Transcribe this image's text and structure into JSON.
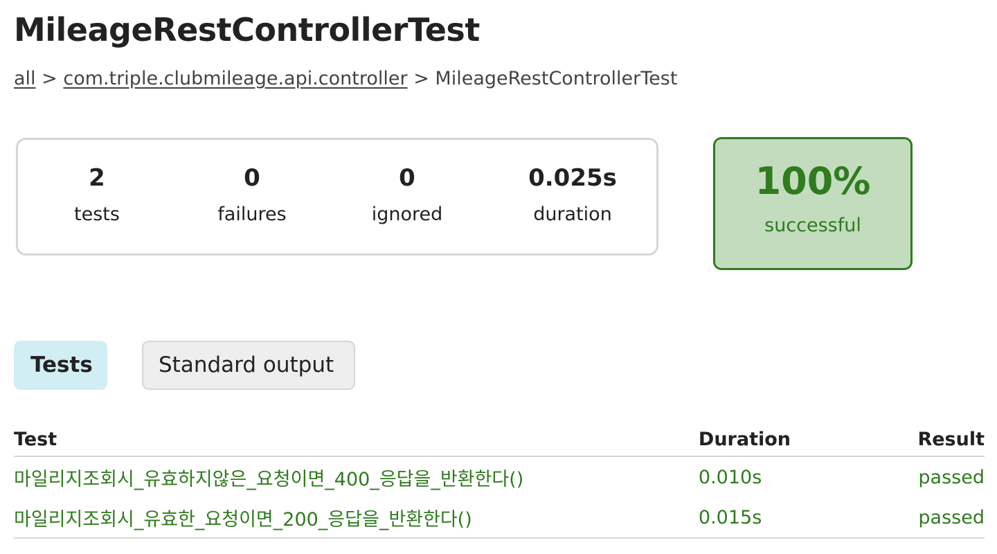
{
  "page": {
    "title": "MileageRestControllerTest"
  },
  "breadcrumb": {
    "items": [
      {
        "label": "all",
        "link": true
      },
      {
        "label": "com.triple.clubmileage.api.controller",
        "link": true
      },
      {
        "label": "MileageRestControllerTest",
        "link": false
      }
    ],
    "separator": ">"
  },
  "summary": {
    "tests": {
      "value": "2",
      "label": "tests"
    },
    "failures": {
      "value": "0",
      "label": "failures"
    },
    "ignored": {
      "value": "0",
      "label": "ignored"
    },
    "duration": {
      "value": "0.025s",
      "label": "duration"
    }
  },
  "success": {
    "percent": "100%",
    "label": "successful",
    "color": "#2f7b1e",
    "background": "#c2dcbd"
  },
  "tabs": [
    {
      "label": "Tests",
      "active": true
    },
    {
      "label": "Standard output",
      "active": false
    }
  ],
  "table": {
    "headers": {
      "test": "Test",
      "duration": "Duration",
      "result": "Result"
    },
    "rows": [
      {
        "test": "마일리지조회시_유효하지않은_요청이면_400_응답을_반환한다()",
        "duration": "0.010s",
        "result": "passed"
      },
      {
        "test": "마일리지조회시_유효한_요청이면_200_응답을_반환한다()",
        "duration": "0.015s",
        "result": "passed"
      }
    ]
  }
}
